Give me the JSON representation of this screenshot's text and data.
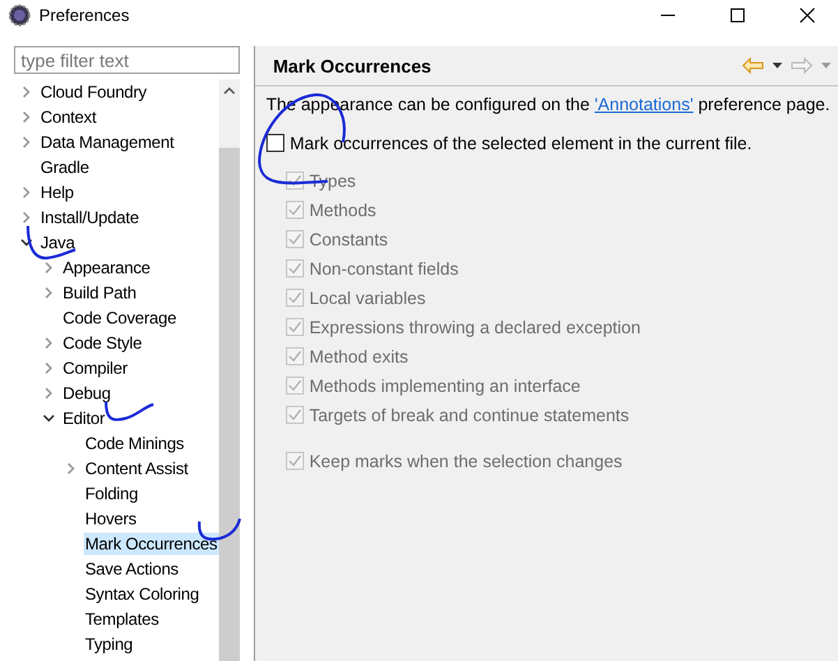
{
  "window": {
    "title": "Preferences"
  },
  "filter": {
    "placeholder": "type filter text"
  },
  "tree": [
    {
      "label": "Cloud Foundry",
      "kind": "branch",
      "expanded": false,
      "selected": false
    },
    {
      "label": "Context",
      "kind": "branch",
      "expanded": false,
      "selected": false
    },
    {
      "label": "Data Management",
      "kind": "branch",
      "expanded": false,
      "selected": false
    },
    {
      "label": "Gradle",
      "kind": "leaf",
      "selected": false
    },
    {
      "label": "Help",
      "kind": "branch",
      "expanded": false,
      "selected": false
    },
    {
      "label": "Install/Update",
      "kind": "branch",
      "expanded": false,
      "selected": false
    },
    {
      "label": "Java",
      "kind": "branch",
      "expanded": true,
      "selected": false,
      "children": [
        {
          "label": "Appearance",
          "kind": "branch",
          "expanded": false,
          "selected": false
        },
        {
          "label": "Build Path",
          "kind": "branch",
          "expanded": false,
          "selected": false
        },
        {
          "label": "Code Coverage",
          "kind": "leaf",
          "selected": false
        },
        {
          "label": "Code Style",
          "kind": "branch",
          "expanded": false,
          "selected": false
        },
        {
          "label": "Compiler",
          "kind": "branch",
          "expanded": false,
          "selected": false
        },
        {
          "label": "Debug",
          "kind": "branch",
          "expanded": false,
          "selected": false
        },
        {
          "label": "Editor",
          "kind": "branch",
          "expanded": true,
          "selected": false,
          "children": [
            {
              "label": "Code Minings",
              "kind": "leaf",
              "selected": false
            },
            {
              "label": "Content Assist",
              "kind": "branch",
              "expanded": false,
              "selected": false
            },
            {
              "label": "Folding",
              "kind": "leaf",
              "selected": false
            },
            {
              "label": "Hovers",
              "kind": "leaf",
              "selected": false
            },
            {
              "label": "Mark Occurrences",
              "kind": "leaf",
              "selected": true
            },
            {
              "label": "Save Actions",
              "kind": "leaf",
              "selected": false
            },
            {
              "label": "Syntax Coloring",
              "kind": "leaf",
              "selected": false
            },
            {
              "label": "Templates",
              "kind": "leaf",
              "selected": false
            },
            {
              "label": "Typing",
              "kind": "leaf",
              "selected": false
            }
          ]
        }
      ]
    }
  ],
  "page": {
    "title": "Mark Occurrences",
    "description_before": "The appearance can be configured on the",
    "link": "'Annotations'",
    "description_after": "preference page.",
    "main_option": {
      "label": "Mark occurrences of the selected element in the current file.",
      "checked": false,
      "disabled": false
    },
    "options": [
      {
        "label": "Types",
        "checked": true,
        "disabled": true
      },
      {
        "label": "Methods",
        "checked": true,
        "disabled": true
      },
      {
        "label": "Constants",
        "checked": true,
        "disabled": true
      },
      {
        "label": "Non-constant fields",
        "checked": true,
        "disabled": true
      },
      {
        "label": "Local variables",
        "checked": true,
        "disabled": true
      },
      {
        "label": "Expressions throwing a declared exception",
        "checked": true,
        "disabled": true
      },
      {
        "label": "Method exits",
        "checked": true,
        "disabled": true
      },
      {
        "label": "Methods implementing an interface",
        "checked": true,
        "disabled": true
      },
      {
        "label": "Targets of break and continue statements",
        "checked": true,
        "disabled": true
      }
    ],
    "extra_option": {
      "label": "Keep marks when the selection changes",
      "checked": true,
      "disabled": true
    }
  }
}
